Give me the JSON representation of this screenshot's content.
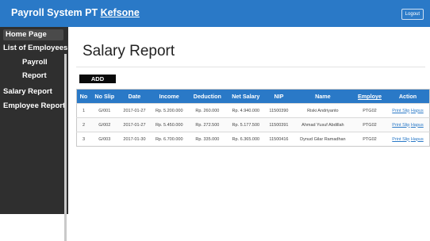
{
  "header": {
    "app_title": "Payroll System PT",
    "company": "Kefsone",
    "logout_label": "Logout"
  },
  "sidebar": {
    "items": [
      {
        "label": "Home Page"
      },
      {
        "label": "List of Employees"
      },
      {
        "label": "Payroll"
      },
      {
        "label": "Report"
      },
      {
        "label": "Salary Report"
      },
      {
        "label": "Employee Report"
      }
    ]
  },
  "main": {
    "title": "Salary Report",
    "add_label": "ADD",
    "table": {
      "headers": [
        "No",
        "No Slip",
        "Date",
        "Income",
        "Deduction",
        "Net Salary",
        "NIP",
        "Name",
        "Employe",
        "Action"
      ],
      "rows": [
        {
          "no": "1",
          "slip": "G/001",
          "date": "2017-01-27",
          "income": "Rp. 5.200.000",
          "deduction": "Rp. 260.000",
          "net": "Rp. 4.940.000",
          "nip": "11500390",
          "name": "Riski Andriyanto",
          "employe": "PTG02",
          "print": "Print Slip",
          "hapus": "Hapus"
        },
        {
          "no": "2",
          "slip": "G/002",
          "date": "2017-01-27",
          "income": "Rp. 5.450.000",
          "deduction": "Rp. 272.500",
          "net": "Rp. 5.177.500",
          "nip": "11500391",
          "name": "Ahmad Yusuf Abdillah",
          "employe": "PTG02",
          "print": "Print Slip",
          "hapus": "Hapus"
        },
        {
          "no": "3",
          "slip": "G/003",
          "date": "2017-01-30",
          "income": "Rp. 6.700.000",
          "deduction": "Rp. 335.000",
          "net": "Rp. 6.365.000",
          "nip": "11500416",
          "name": "Dynud Gilar Ramadhan",
          "employe": "PTG02",
          "print": "Print Slip",
          "hapus": "Hapus"
        }
      ]
    }
  },
  "colors": {
    "primary": "#2a79c7",
    "sidebar": "#2f2f2f",
    "add_button": "#0a0a0a"
  }
}
